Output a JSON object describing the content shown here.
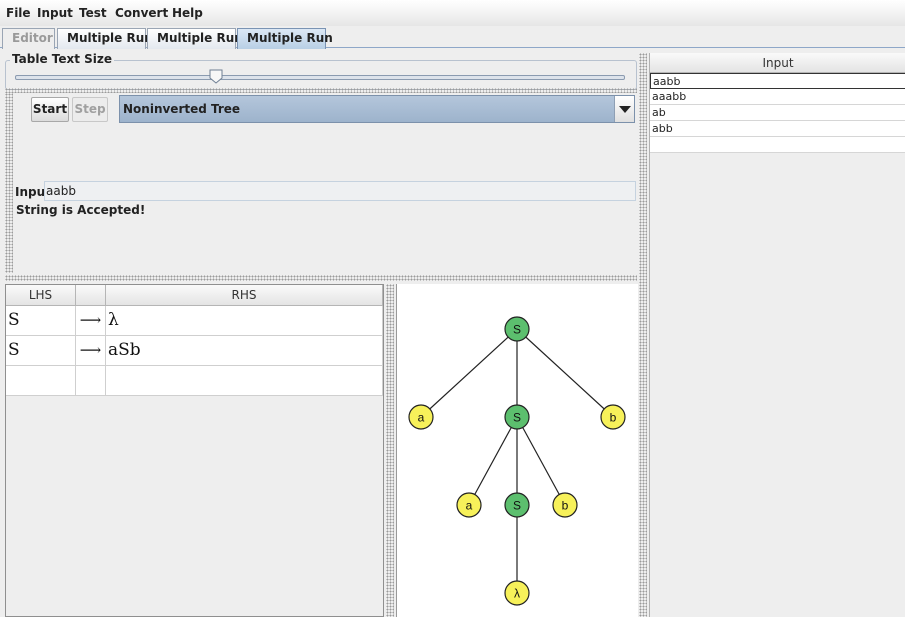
{
  "menu": [
    "File",
    "Input",
    "Test",
    "Convert",
    "Help"
  ],
  "tabs": [
    {
      "label": "Editor",
      "state": "disabled"
    },
    {
      "label": "Multiple Run",
      "state": "normal"
    },
    {
      "label": "Multiple Run",
      "state": "normal"
    },
    {
      "label": "Multiple Run",
      "state": "active"
    }
  ],
  "table_text_size": {
    "title": "Table Text Size",
    "slider_value_fraction": 0.33
  },
  "controls": {
    "start_label": "Start",
    "step_label": "Step",
    "view_mode": "Noninverted Tree",
    "input_label": "Input",
    "input_value": "aabb",
    "status": "String is Accepted!"
  },
  "grammar": {
    "headers": {
      "lhs": "LHS",
      "arrow": "",
      "rhs": "RHS"
    },
    "rows": [
      {
        "lhs": "S",
        "arrow": "⟶",
        "rhs": "λ"
      },
      {
        "lhs": "S",
        "arrow": "⟶",
        "rhs": "aSb"
      },
      {
        "lhs": "",
        "arrow": "",
        "rhs": ""
      }
    ]
  },
  "tree": {
    "nodes": [
      "S",
      "a",
      "S",
      "b",
      "a",
      "S",
      "b",
      "λ"
    ],
    "colors": {
      "variable": "#5cbf6e",
      "terminal": "#f7f15a",
      "stroke": "#222222"
    }
  },
  "input_list": {
    "header": "Input",
    "items": [
      "aabb",
      "aaabb",
      "ab",
      "abb",
      ""
    ]
  }
}
